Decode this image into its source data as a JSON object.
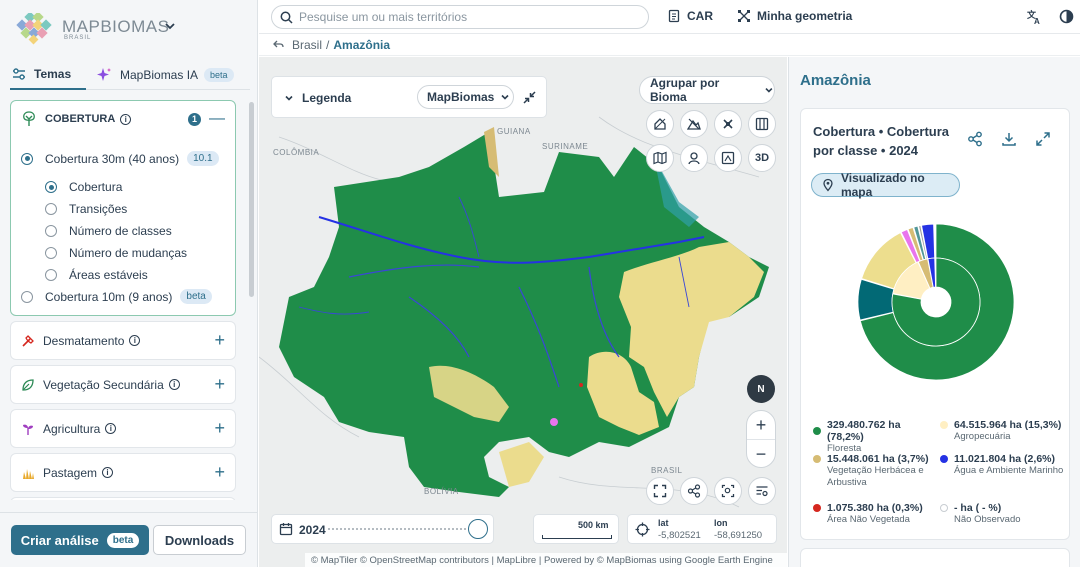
{
  "app": {
    "name": "MAPBIOMAS",
    "sub": "BRASIL"
  },
  "tabs": [
    {
      "label": "Temas"
    },
    {
      "label": "MapBiomas IA",
      "badge": "beta"
    }
  ],
  "cobertura": {
    "title": "COBERTURA",
    "count": "1",
    "options": [
      {
        "label": "Cobertura 30m (40 anos)",
        "chip": "10.1"
      },
      {
        "label": "Cobertura 10m (9 anos)",
        "chip": "beta"
      }
    ],
    "sub_options": [
      "Cobertura",
      "Transições",
      "Número de classes",
      "Número de mudanças",
      "Áreas estáveis"
    ]
  },
  "themes": [
    {
      "label": "Desmatamento",
      "icon": "axe-icon"
    },
    {
      "label": "Vegetação Secundária",
      "icon": "leaf-icon"
    },
    {
      "label": "Agricultura",
      "icon": "sprout-icon"
    },
    {
      "label": "Pastagem",
      "icon": "grass-icon"
    }
  ],
  "buttons": {
    "analysis": "Criar análise",
    "analysis_badge": "beta",
    "downloads": "Downloads"
  },
  "search": {
    "placeholder": "Pesquise um ou mais territórios"
  },
  "toplinks": {
    "car": "CAR",
    "geometry": "Minha geometria"
  },
  "breadcrumb": {
    "root": "Brasil",
    "sep": "/",
    "current": "Amazônia"
  },
  "map": {
    "legend_title": "Legenda",
    "legend_select": "MapBiomas",
    "group_select": "Agrupar por Bioma",
    "btn_3d": "3D",
    "compass": "N",
    "zoom_in": "+",
    "zoom_out": "−",
    "year": "2024",
    "year_fraction": 1.0,
    "scale": "500 km",
    "lat_label": "lat",
    "lon_label": "lon",
    "lat_value": "-5,802521",
    "lon_value": "-58,691250",
    "labels": [
      "GUIANA",
      "COLÔMBIA",
      "SURINAME",
      "BRASIL",
      "BOLÍVIA"
    ],
    "attribution": "© MapTiler © OpenStreetMap contributors | MapLibre | Powered by © MapBiomas using Google Earth Engine"
  },
  "panel": {
    "title": "Amazônia",
    "chart_title": "Cobertura • Cobertura por classe • 2024",
    "visualized": "Visualizado no mapa",
    "legend": [
      {
        "value": "329.480.762 ha (78,2%)",
        "name": "Floresta",
        "color": "#1f8d49"
      },
      {
        "value": "64.515.964 ha (15,3%)",
        "name": "Agropecuária",
        "color": "#ffefc3"
      },
      {
        "value": "15.448.061 ha (3,7%)",
        "name": "Vegetação Herbácea e Arbustiva",
        "color": "#d6bc74"
      },
      {
        "value": "11.021.804 ha (2,6%)",
        "name": "Água e Ambiente Marinho",
        "color": "#2532e4"
      },
      {
        "value": "1.075.380 ha (0,3%)",
        "name": "Área Não Vegetada",
        "color": "#d5271f"
      },
      {
        "value": "- ha ( - %)",
        "name": "Não Observado",
        "color": "#ffffff"
      }
    ]
  },
  "chart_data": {
    "type": "pie",
    "title": "Cobertura • Cobertura por classe • 2024",
    "inner_ring": [
      {
        "name": "Floresta",
        "value": 78.2,
        "color": "#1f8d49"
      },
      {
        "name": "Agropecuária",
        "value": 15.3,
        "color": "#ffefc3"
      },
      {
        "name": "Vegetação Herbácea e Arbustiva",
        "value": 3.7,
        "color": "#d6bc74"
      },
      {
        "name": "Água e Ambiente Marinho",
        "value": 2.6,
        "color": "#2532e4"
      },
      {
        "name": "Área Não Vegetada",
        "value": 0.3,
        "color": "#d5271f"
      }
    ],
    "outer_ring": [
      {
        "value": 69.8,
        "color": "#1f8d49"
      },
      {
        "value": 8.4,
        "color": "#026975"
      },
      {
        "value": 12.5,
        "color": "#edde8e"
      },
      {
        "value": 1.5,
        "color": "#e974ed"
      },
      {
        "value": 1.2,
        "color": "#d6bc74"
      },
      {
        "value": 1.0,
        "color": "#519799"
      },
      {
        "value": 0.6,
        "color": "#9c9c9c"
      },
      {
        "value": 2.6,
        "color": "#2532e4"
      },
      {
        "value": 0.3,
        "color": "#d5271f"
      }
    ]
  }
}
